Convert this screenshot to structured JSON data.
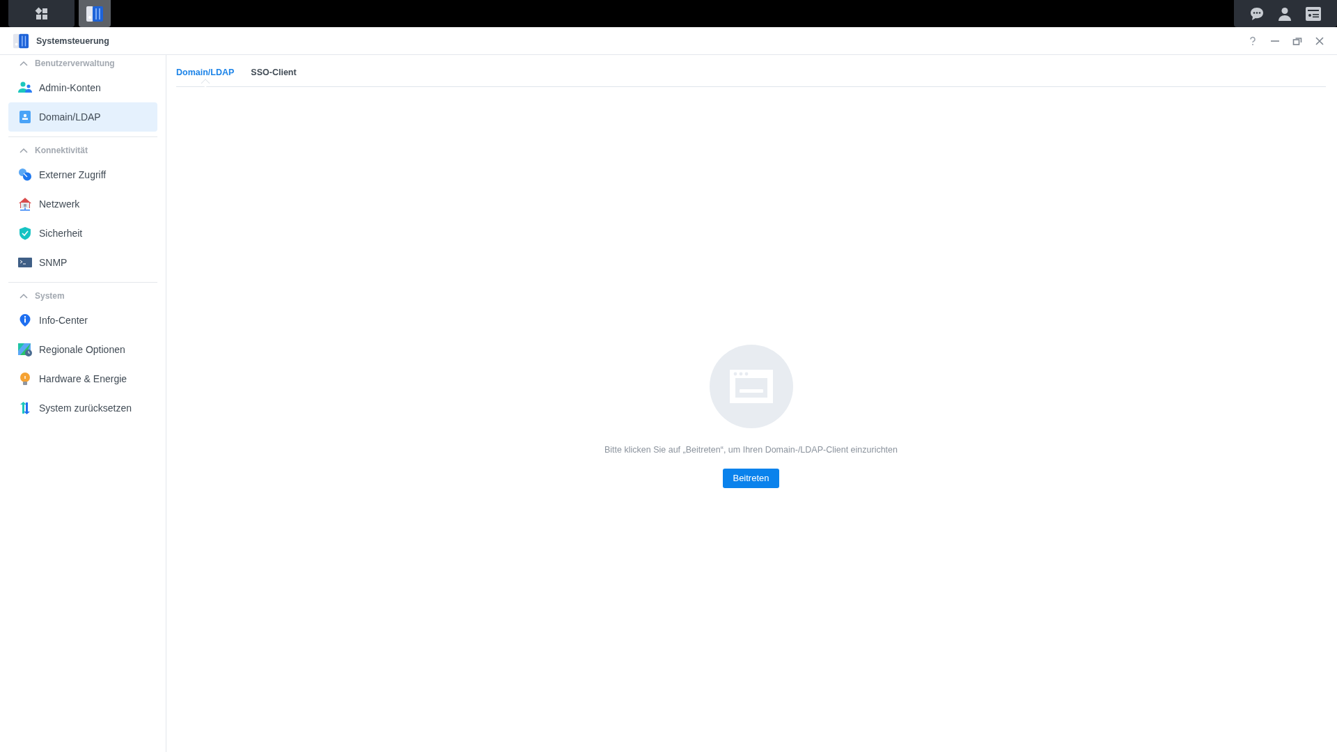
{
  "window": {
    "title": "Systemsteuerung"
  },
  "sidebar": {
    "sections": [
      {
        "title": "Benutzerverwaltung",
        "expanded": true,
        "items": [
          {
            "label": "Admin-Konten",
            "selected": false
          },
          {
            "label": "Domain/LDAP",
            "selected": true
          }
        ]
      },
      {
        "title": "Konnektivität",
        "expanded": true,
        "items": [
          {
            "label": "Externer Zugriff",
            "selected": false
          },
          {
            "label": "Netzwerk",
            "selected": false
          },
          {
            "label": "Sicherheit",
            "selected": false
          },
          {
            "label": "SNMP",
            "selected": false
          }
        ]
      },
      {
        "title": "System",
        "expanded": true,
        "items": [
          {
            "label": "Info-Center",
            "selected": false
          },
          {
            "label": "Regionale Optionen",
            "selected": false
          },
          {
            "label": "Hardware & Energie",
            "selected": false
          },
          {
            "label": "System zurücksetzen",
            "selected": false
          }
        ]
      }
    ]
  },
  "tabs": [
    {
      "label": "Domain/LDAP",
      "selected": true
    },
    {
      "label": "SSO-Client",
      "selected": false
    }
  ],
  "empty_state": {
    "message": "Bitte klicken Sie auf „Beitreten“, um Ihren Domain-/LDAP-Client einzurichten",
    "button": "Beitreten"
  }
}
